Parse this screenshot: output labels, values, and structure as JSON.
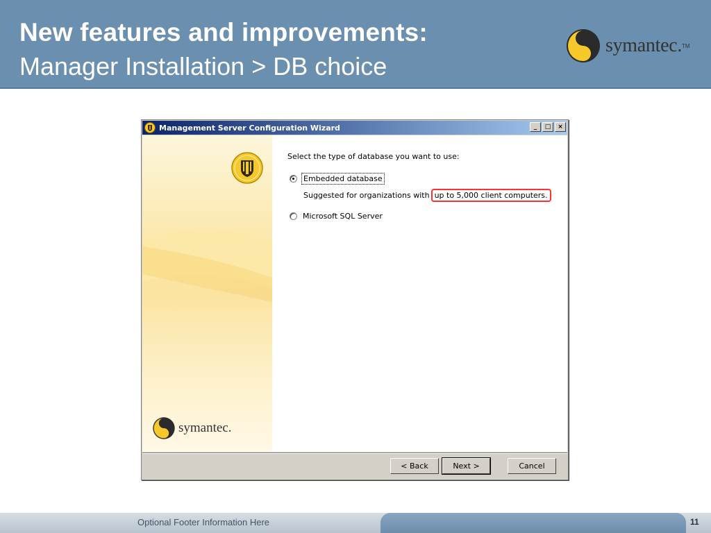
{
  "slide": {
    "title_line1": "New features and improvements:",
    "title_line2": "Manager Installation > DB choice",
    "logo_text": "symantec.",
    "logo_tm": "TM",
    "footer_text": "Optional Footer Information Here",
    "page_number": "11"
  },
  "window": {
    "title": "Management Server Configuration Wizard",
    "controls": {
      "minimize": "_",
      "maximize": "□",
      "close": "×"
    },
    "side_logo_text": "symantec.",
    "prompt": "Select the type of database you want to use:",
    "options": [
      {
        "label": "Embedded database",
        "selected": true
      },
      {
        "label": "Microsoft SQL Server",
        "selected": false
      }
    ],
    "note_text": "Suggested for organizations with",
    "note_highlight": "up to 5,000 client computers.",
    "buttons": {
      "back": "< Back",
      "next": "Next >",
      "cancel": "Cancel"
    }
  },
  "colors": {
    "header_bg": "#6b8fae",
    "titlebar_start": "#0a246a",
    "highlight_border": "#ff3030",
    "logo_yellow": "#f6c82a"
  }
}
